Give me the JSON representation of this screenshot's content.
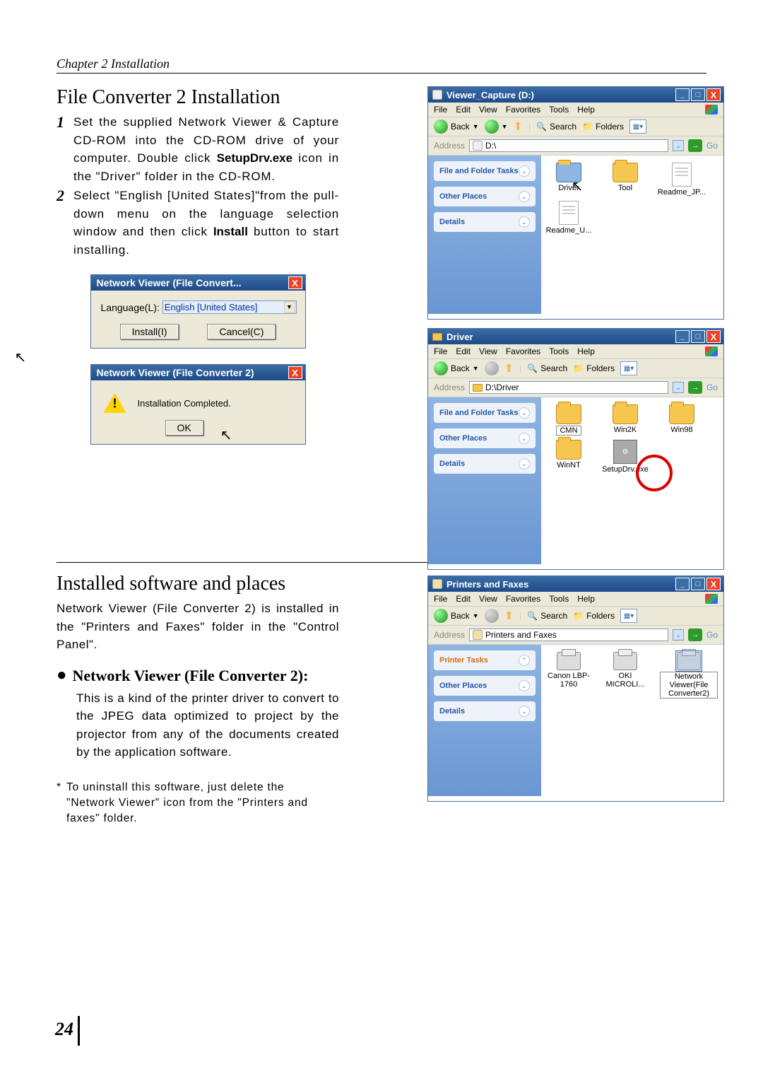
{
  "chapter_header": "Chapter 2 Installation",
  "section_title_1": "File Converter 2 Installation",
  "step1": "Set the supplied Network Viewer & Capture CD-ROM into the CD-ROM drive of your computer. Double click ",
  "step1_bold": "SetupDrv.exe",
  "step1_tail": " icon in the \"Driver\" folder in the CD-ROM.",
  "step2": "Select \"English [United States]\"from the pull-down menu on the language selection window and then click ",
  "step2_bold": "Install",
  "step2_tail": " button to start installing.",
  "dlg1": {
    "title": "Network Viewer (File Convert...",
    "lang_label": "Language(L):",
    "lang_value": "English [United States]",
    "install": "Install(I)",
    "cancel": "Cancel(C)"
  },
  "dlg2": {
    "title": "Network Viewer (File Converter 2)",
    "msg": "Installation Completed.",
    "ok": "OK"
  },
  "menus": [
    "File",
    "Edit",
    "View",
    "Favorites",
    "Tools",
    "Help"
  ],
  "toolbar": {
    "back": "Back",
    "search": "Search",
    "folders": "Folders"
  },
  "addr_label": "Address",
  "go": "Go",
  "side": {
    "tasks": "File and Folder Tasks",
    "other": "Other Places",
    "details": "Details",
    "ptasks": "Printer Tasks"
  },
  "exp1": {
    "title": "Viewer_Capture (D:)",
    "addr": "D:\\",
    "items": [
      "Driver",
      "Tool",
      "Readme_JP...",
      "Readme_U..."
    ]
  },
  "exp2": {
    "title": "Driver",
    "addr": "D:\\Driver",
    "items": [
      "CMN",
      "Win2K",
      "Win98",
      "WinNT",
      "SetupDrv.exe"
    ]
  },
  "exp3": {
    "title": "Printers and Faxes",
    "addr": "Printers and Faxes",
    "items": [
      "Canon LBP-1760",
      "OKI MICROLI...",
      "Network Viewer(File Converter2)"
    ]
  },
  "section_title_2": "Installed software and places",
  "installed_para": "Network Viewer (File Converter 2) is installed in the \"Printers and Faxes\" folder in the \"Control Panel\".",
  "bullet1_title": "Network Viewer (File Converter 2):",
  "bullet1_body": "This is a kind of the printer driver to convert to the JPEG data optimized to project by the projector from any of the documents created by the application software.",
  "footnote": "To uninstall this software, just delete the \"Network Viewer\" icon from the \"Printers and faxes\" folder.",
  "page_number": "24"
}
